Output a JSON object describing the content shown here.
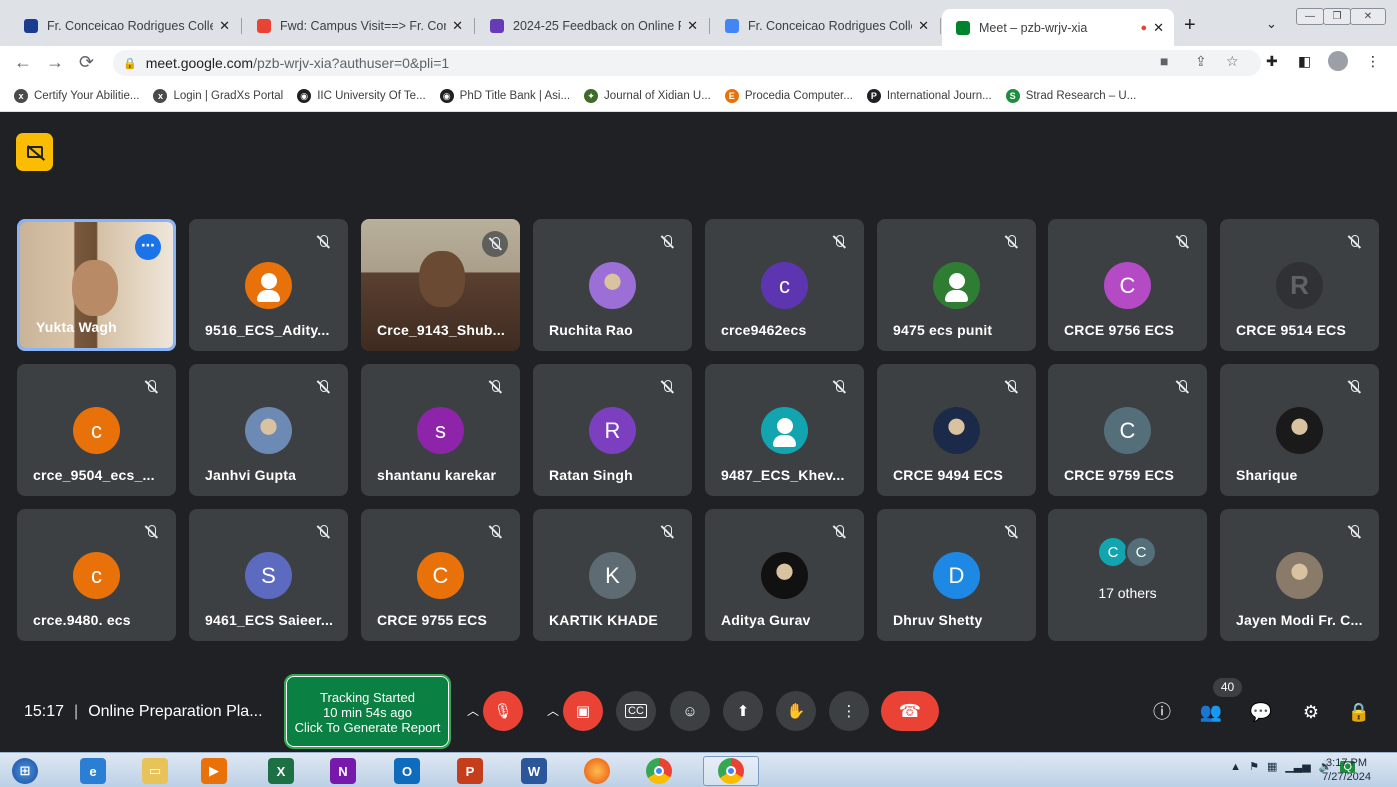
{
  "browser": {
    "tabs": [
      {
        "title": "Fr. Conceicao Rodrigues Colleg",
        "fav_color": "#1a3d8f"
      },
      {
        "title": "Fwd: Campus Visit==> Fr. Conc",
        "fav_color": "#ea4335"
      },
      {
        "title": "2024-25 Feedback on Online F",
        "fav_color": "#673ab7"
      },
      {
        "title": "Fr. Conceicao Rodrigues Colleg",
        "fav_color": "#4285f4"
      },
      {
        "title": "Meet – pzb-wrjv-xia",
        "fav_color": "#00832d"
      }
    ],
    "address_host": "meet.google.com",
    "address_path": "/pzb-wrjv-xia?authuser=0&pli=1",
    "bookmarks": [
      "Certify Your Abilitie...",
      "Login | GradXs Portal",
      "IIC University Of Te...",
      "PhD Title Bank | Asi...",
      "Journal of Xidian U...",
      "Procedia Computer...",
      "International Journ...",
      "Strad Research – U..."
    ]
  },
  "meet": {
    "tiles": [
      {
        "name": "Yukta Wagh",
        "kind": "video",
        "active": true
      },
      {
        "name": "9516_ECS_Adity...",
        "kind": "generic",
        "color": "#e8710a"
      },
      {
        "name": "Crce_9143_Shub...",
        "kind": "video"
      },
      {
        "name": "Ruchita Rao",
        "kind": "photo",
        "color": "#9c6fd6"
      },
      {
        "name": "crce9462ecs",
        "kind": "letter",
        "letter": "c",
        "color": "#5e35b1"
      },
      {
        "name": "9475 ecs punit",
        "kind": "generic",
        "color": "#2e7d32"
      },
      {
        "name": "CRCE 9756 ECS",
        "kind": "letter",
        "letter": "C",
        "color": "#b44ac4"
      },
      {
        "name": "CRCE 9514 ECS",
        "kind": "letter",
        "letter": "R",
        "color": "#303134"
      },
      {
        "name": "crce_9504_ecs_...",
        "kind": "letter",
        "letter": "c",
        "color": "#e8710a"
      },
      {
        "name": "Janhvi Gupta",
        "kind": "photo",
        "color": "#6d8ab5"
      },
      {
        "name": "shantanu karekar",
        "kind": "letter",
        "letter": "s",
        "color": "#8e24aa"
      },
      {
        "name": "Ratan Singh",
        "kind": "letter",
        "letter": "R",
        "color": "#7b3fbf"
      },
      {
        "name": "9487_ECS_Khev...",
        "kind": "generic",
        "color": "#12a4af"
      },
      {
        "name": "CRCE 9494 ECS",
        "kind": "photo",
        "color": "#1c2a4a"
      },
      {
        "name": "CRCE 9759 ECS",
        "kind": "letter",
        "letter": "C",
        "color": "#546e7a"
      },
      {
        "name": "Sharique",
        "kind": "photo",
        "color": "#1a1a1a"
      },
      {
        "name": "crce.9480. ecs",
        "kind": "letter",
        "letter": "c",
        "color": "#e8710a"
      },
      {
        "name": "9461_ECS Saieer...",
        "kind": "letter",
        "letter": "S",
        "color": "#5c6bc0"
      },
      {
        "name": "CRCE 9755 ECS",
        "kind": "letter",
        "letter": "C",
        "color": "#e8710a"
      },
      {
        "name": "KARTIK KHADE",
        "kind": "letter",
        "letter": "K",
        "color": "#5f6b73"
      },
      {
        "name": "Aditya Gurav",
        "kind": "photo",
        "color": "#111111"
      },
      {
        "name": "Dhruv Shetty",
        "kind": "letter",
        "letter": "D",
        "color": "#1e88e5"
      },
      {
        "name": "17 others",
        "kind": "others"
      },
      {
        "name": "Jayen Modi Fr. C...",
        "kind": "photo",
        "color": "#8a7a6a"
      }
    ],
    "others_letters": [
      "C",
      "C"
    ],
    "time": "15:17",
    "meeting_title": "Online Preparation Pla...",
    "tracking": {
      "line1": "Tracking Started",
      "line2": "10 min 54s ago",
      "line3": "Click To Generate Report"
    },
    "participant_count": "40"
  },
  "taskbar": {
    "time": "3:17 PM",
    "date": "7/27/2024"
  }
}
